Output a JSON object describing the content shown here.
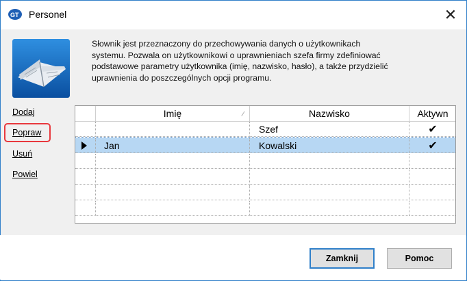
{
  "window": {
    "title": "Personel"
  },
  "description": "Słownik jest przeznaczony do przechowywania danych o użytkownikach\nsystemu. Pozwala on użytkownikowi o uprawnieniach szefa firmy zdefiniować\npodstawowe parametry użytkownika (imię, nazwisko, hasło), a także przydzielić\nuprawnienia do poszczególnych opcji programu.",
  "sidebar": {
    "items": [
      {
        "label": "Dodaj"
      },
      {
        "label": "Popraw"
      },
      {
        "label": "Usuń"
      },
      {
        "label": "Powiel"
      }
    ]
  },
  "table": {
    "columns": [
      "Imię",
      "Nazwisko",
      "Aktywn"
    ],
    "rows": [
      {
        "imie": "",
        "nazwisko": "Szef",
        "aktywny": "✔"
      },
      {
        "imie": "Jan",
        "nazwisko": "Kowalski",
        "aktywny": "✔"
      }
    ]
  },
  "buttons": {
    "close": "Zamknij",
    "help": "Pomoc"
  },
  "colors": {
    "accent": "#2f7fc9",
    "selection": "#b7d7f3",
    "highlight": "#e8383d"
  }
}
